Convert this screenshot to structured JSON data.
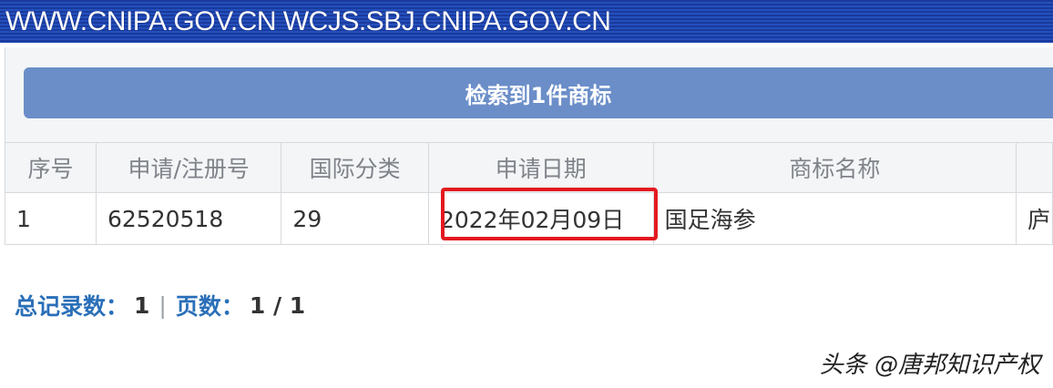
{
  "header": {
    "site_text": "WWW.CNIPA.GOV.CN WCJS.SBJ.CNIPA.GOV.CN"
  },
  "result_banner": {
    "text": "检索到1件商标"
  },
  "table": {
    "columns": [
      "序号",
      "申请/注册号",
      "国际分类",
      "申请日期",
      "商标名称",
      ""
    ],
    "rows": [
      {
        "index": "1",
        "reg_no": "62520518",
        "class": "29",
        "date": "2022年02月09日",
        "name": "国足海参",
        "extra": "庐"
      }
    ]
  },
  "pager": {
    "total_label": "总记录数：",
    "total_value": "1",
    "pages_label": "页数：",
    "pages_value": "1 / 1"
  },
  "watermark": {
    "text": "头条 @唐邦知识产权"
  },
  "colors": {
    "topbar": "#2450bd",
    "banner": "#6b8ec9",
    "link": "#2a6fb8",
    "highlight": "#e3191f"
  }
}
